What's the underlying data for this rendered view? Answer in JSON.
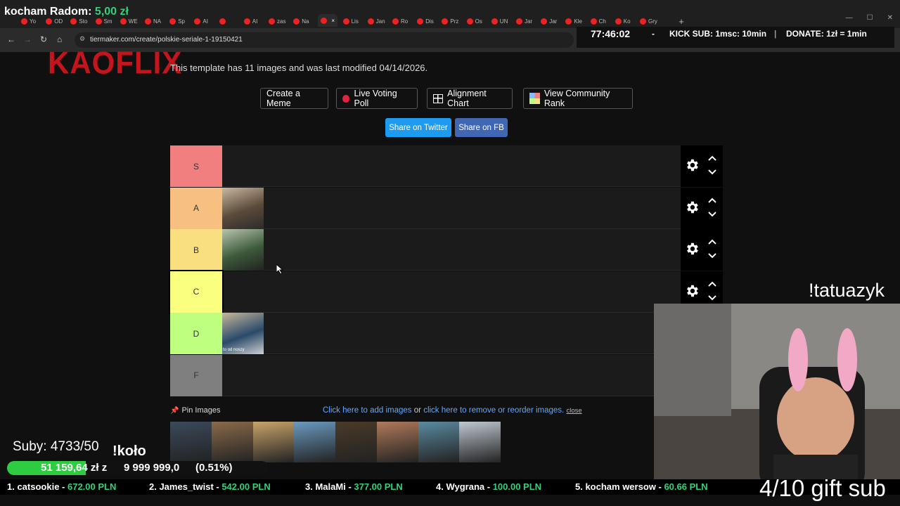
{
  "browser": {
    "tabs": [
      "Yo",
      "OD",
      "Sto",
      "Sm",
      "WE",
      "NA",
      "Sp",
      "AI",
      "",
      "AI",
      "zas",
      "Na",
      "",
      "Lis",
      "Jan",
      "Ro",
      "Dis",
      "Prz",
      "Os",
      "UN",
      "Jar",
      "Jar",
      "Kle",
      "Ch",
      "Ko",
      "Gry"
    ],
    "active_tab_index": 12,
    "url": "tiermaker.com/create/polskie-seriale-1-19150421",
    "new_tab_label": "+",
    "close_label": "×"
  },
  "overlay": {
    "donation_title": "kocham Radom: ",
    "donation_amount": "5,00 zł",
    "timer": "77:46:02",
    "separator": "-",
    "kick_sub": "KICK SUB: 1msc: 10min",
    "divider": "|",
    "donate": "DONATE: 1zł = 1min",
    "subs": "Suby: 4733/50",
    "kolo": "!koło",
    "goal_amount": "51 159,64 zł z",
    "goal_target": "9 999 999,0",
    "goal_percent": "(0.51%)",
    "goal_fraction": 0.0051,
    "tatuazyk": "!tatuazyk",
    "gift_sub": "4/10 gift sub",
    "ticker": [
      {
        "name": "1. catsookie - ",
        "amount": "672.00 PLN"
      },
      {
        "name": "2. James_twist - ",
        "amount": "542.00 PLN"
      },
      {
        "name": "3. MalaMi - ",
        "amount": "377.00 PLN"
      },
      {
        "name": "4. Wygrana - ",
        "amount": "100.00 PLN"
      },
      {
        "name": "5. kocham wersow - ",
        "amount": "60.66 PLN"
      }
    ]
  },
  "page": {
    "logo": "KAOFLIX",
    "template_info": "This template has 11 images and was last modified 04/14/2026.",
    "buttons": {
      "meme": "Create a Meme",
      "poll": "Live Voting Poll",
      "alignment": "Alignment Chart",
      "community": "View Community Rank"
    },
    "share_twitter": "Share on Twitter",
    "share_fb": "Share on FB",
    "tiers": [
      {
        "label": "S",
        "color": "#f27f80",
        "items": 0
      },
      {
        "label": "A",
        "color": "#f7bf80",
        "items": 1
      },
      {
        "label": "B",
        "color": "#f9df80",
        "items": 1
      },
      {
        "label": "C",
        "color": "#fbff80",
        "items": 0
      },
      {
        "label": "D",
        "color": "#bfff7f",
        "items": 1
      },
      {
        "label": "F",
        "color": "#7f7f7f",
        "items": 0
      }
    ],
    "d_thumb_caption": "to od noszy",
    "pin_images": "Pin Images",
    "add_images": "Click here to add images",
    "or": " or ",
    "remove_images": "click here to remove or reorder images.",
    "close": "close",
    "pool_count": 8,
    "colors": {
      "twitter": "#1d9bf0",
      "fb": "#4267b2",
      "logo": "#c4141c",
      "link": "#5fa8ff"
    }
  }
}
